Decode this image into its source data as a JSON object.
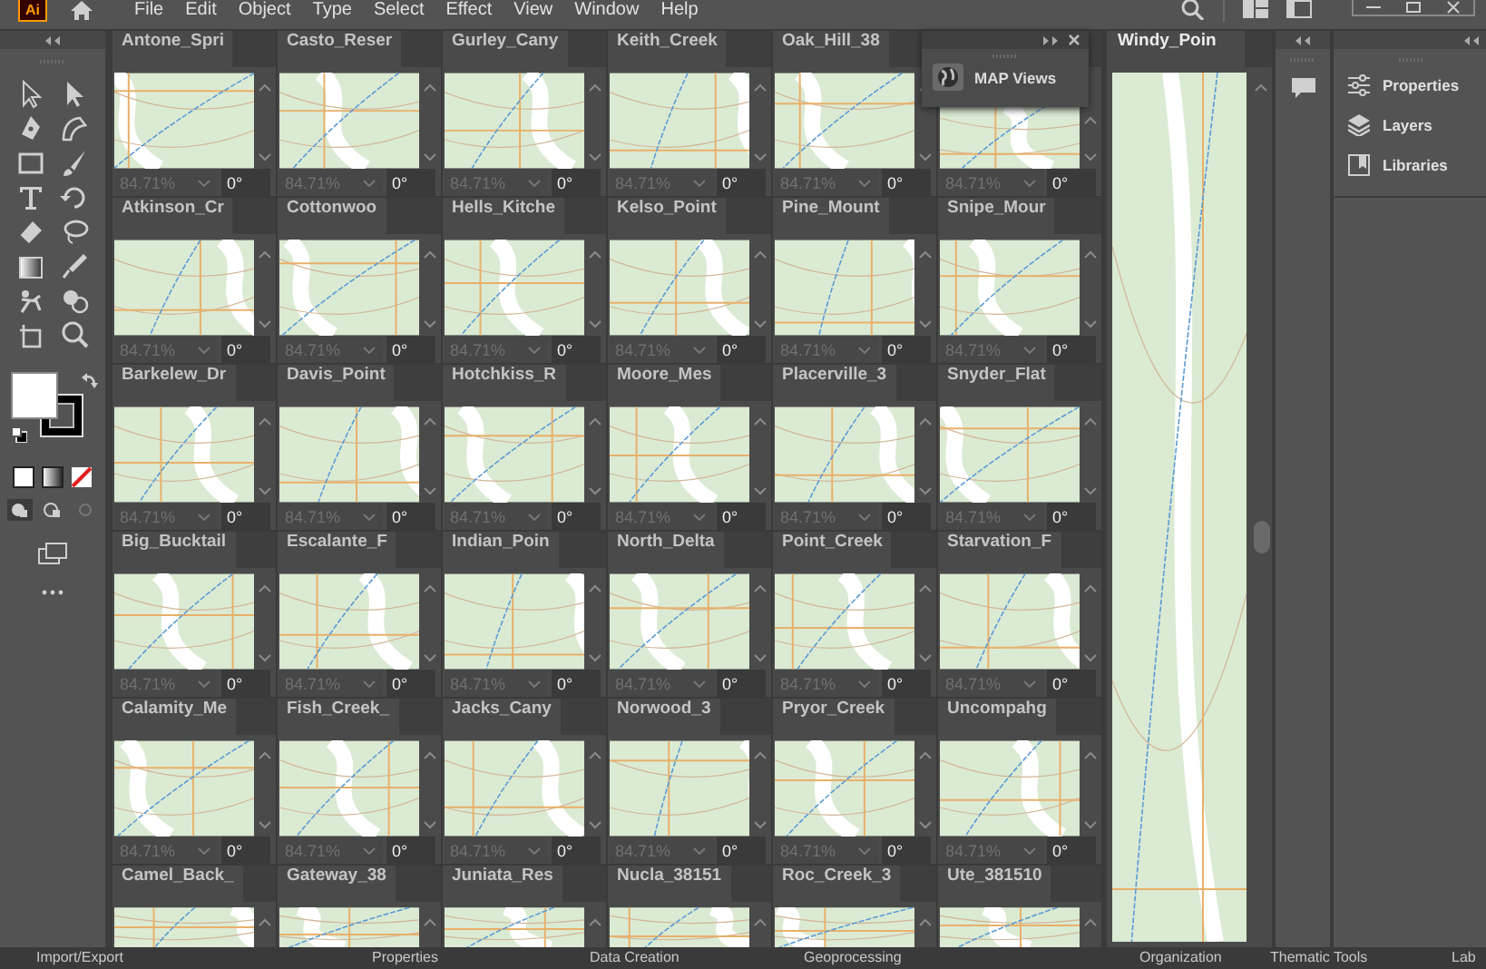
{
  "menu_bar": {
    "logo": "Ai",
    "items": [
      "File",
      "Edit",
      "Object",
      "Type",
      "Select",
      "Effect",
      "View",
      "Window",
      "Help"
    ]
  },
  "map_cells": [
    {
      "title": "Antone_Spri",
      "zoom": "84.71%",
      "angle": "0°"
    },
    {
      "title": "Casto_Reser",
      "zoom": "84.71%",
      "angle": "0°"
    },
    {
      "title": "Gurley_Cany",
      "zoom": "84.71%",
      "angle": "0°"
    },
    {
      "title": "Keith_Creek",
      "zoom": "84.71%",
      "angle": "0°"
    },
    {
      "title": "Oak_Hill_38",
      "zoom": "84.71%",
      "angle": "0°"
    },
    {
      "zoom": "84.71%",
      "angle": "0°"
    },
    {
      "title": "Atkinson_Cr",
      "zoom": "84.71%",
      "angle": "0°"
    },
    {
      "title": "Cottonwoo",
      "zoom": "84.71%",
      "angle": "0°"
    },
    {
      "title": "Hells_Kitche",
      "zoom": "84.71%",
      "angle": "0°"
    },
    {
      "title": "Kelso_Point",
      "zoom": "84.71%",
      "angle": "0°"
    },
    {
      "title": "Pine_Mount",
      "zoom": "84.71%",
      "angle": "0°"
    },
    {
      "title": "Snipe_Mour",
      "zoom": "84.71%",
      "angle": "0°"
    },
    {
      "title": "Barkelew_Dr",
      "zoom": "84.71%",
      "angle": "0°"
    },
    {
      "title": "Davis_Point",
      "zoom": "84.71%",
      "angle": "0°"
    },
    {
      "title": "Hotchkiss_R",
      "zoom": "84.71%",
      "angle": "0°"
    },
    {
      "title": "Moore_Mes",
      "zoom": "84.71%",
      "angle": "0°"
    },
    {
      "title": "Placerville_3",
      "zoom": "84.71%",
      "angle": "0°"
    },
    {
      "title": "Snyder_Flat",
      "zoom": "84.71%",
      "angle": "0°"
    },
    {
      "title": "Big_Bucktail",
      "zoom": "84.71%",
      "angle": "0°"
    },
    {
      "title": "Escalante_F",
      "zoom": "84.71%",
      "angle": "0°"
    },
    {
      "title": "Indian_Poin",
      "zoom": "84.71%",
      "angle": "0°"
    },
    {
      "title": "North_Delta",
      "zoom": "84.71%",
      "angle": "0°"
    },
    {
      "title": "Point_Creek",
      "zoom": "84.71%",
      "angle": "0°"
    },
    {
      "title": "Starvation_F",
      "zoom": "84.71%",
      "angle": "0°"
    },
    {
      "title": "Calamity_Me",
      "zoom": "84.71%",
      "angle": "0°"
    },
    {
      "title": "Fish_Creek_",
      "zoom": "84.71%",
      "angle": "0°"
    },
    {
      "title": "Jacks_Cany",
      "zoom": "84.71%",
      "angle": "0°"
    },
    {
      "title": "Norwood_3",
      "zoom": "84.71%",
      "angle": "0°"
    },
    {
      "title": "Pryor_Creek",
      "zoom": "84.71%",
      "angle": "0°"
    },
    {
      "title": "Uncompahg",
      "zoom": "84.71%",
      "angle": "0°"
    },
    {
      "title": "Camel_Back_"
    },
    {
      "title": "Gateway_38"
    },
    {
      "title": "Juniata_Res"
    },
    {
      "title": "Nucla_38151"
    },
    {
      "title": "Roc_Creek_3"
    },
    {
      "title": "Ute_381510"
    }
  ],
  "map_views_panel": {
    "title": "MAP Views"
  },
  "side_map": {
    "title": "Windy_Poin"
  },
  "right_panel": {
    "items": [
      {
        "kind": "properties",
        "label": "Properties"
      },
      {
        "kind": "layers",
        "label": "Layers"
      },
      {
        "kind": "libraries",
        "label": "Libraries"
      }
    ]
  },
  "bottom_tabs": [
    "Import/Export",
    "Properties",
    "Data Creation",
    "Geoprocessing",
    "Organization",
    "Thematic Tools",
    "Lab"
  ]
}
